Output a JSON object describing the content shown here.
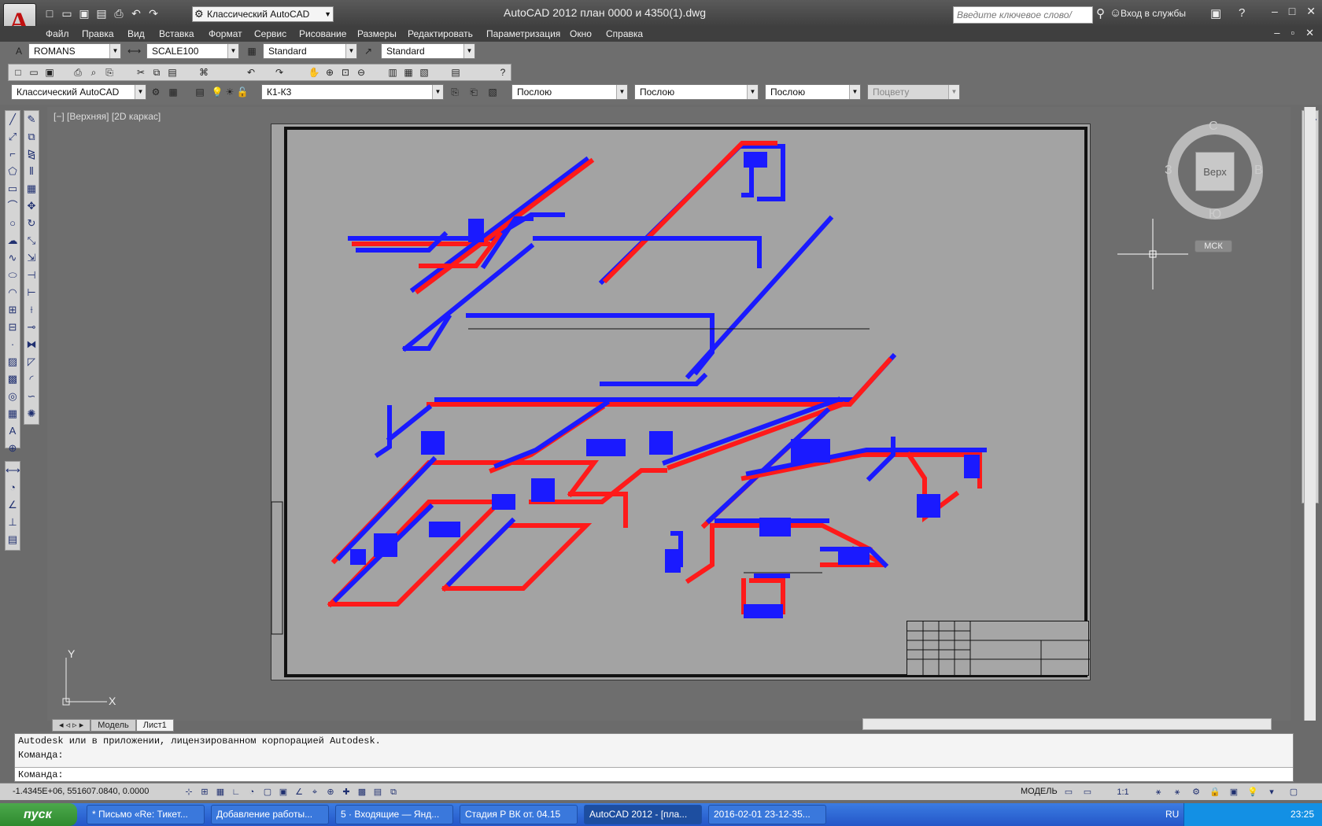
{
  "titlebar": {
    "app_title": "AutoCAD 2012    план 0000 и 4350(1).dwg",
    "workspace": "Классический AutoCAD",
    "search_placeholder": "Введите ключевое слово/фразу",
    "login": "Вход в службы"
  },
  "menu": [
    "Файл",
    "Правка",
    "Вид",
    "Вставка",
    "Формат",
    "Сервис",
    "Рисование",
    "Размеры",
    "Редактировать",
    "Параметризация",
    "Окно",
    "Справка"
  ],
  "styles": {
    "text_style": "ROMANS",
    "dim_style": "SCALE100",
    "table_style": "Standard",
    "mleader_style": "Standard"
  },
  "layers": {
    "workspace": "Классический AutoCAD",
    "current_layer": "К1-К3",
    "color": "Послою",
    "linetype": "Послою",
    "lineweight": "Послою",
    "plotstyle": "Поцвету"
  },
  "viewport": {
    "label": "[−] [Верхняя] [2D каркас]",
    "viewcube_face": "Верх",
    "north": "С",
    "south": "Ю",
    "west": "З",
    "east": "В",
    "ucs": "МСК"
  },
  "tabs": [
    "Модель",
    "Лист1"
  ],
  "command": {
    "line1": "Autodesk или в приложении, лицензированном корпорацией Autodesk.",
    "line2": "Команда:",
    "prompt": "Команда:"
  },
  "status": {
    "coords": "-1.4345E+06, 551607.0840, 0.0000",
    "model": "МОДЕЛЬ",
    "scale": "1:1"
  },
  "taskbar": {
    "start": "пуск",
    "tasks": [
      "* Письмо «Re: Тикет...",
      "Добавление работы...",
      "5 · Входящие — Янд...",
      "Стадия Р ВК от. 04.15",
      "AutoCAD 2012 - [пла...",
      "2016-02-01 23-12-35..."
    ],
    "lang": "RU",
    "clock": "23:25"
  },
  "colors": {
    "pipe_red": "#ff1a1a",
    "pipe_blue": "#1a1aff",
    "paper": "#a3a3a3"
  }
}
